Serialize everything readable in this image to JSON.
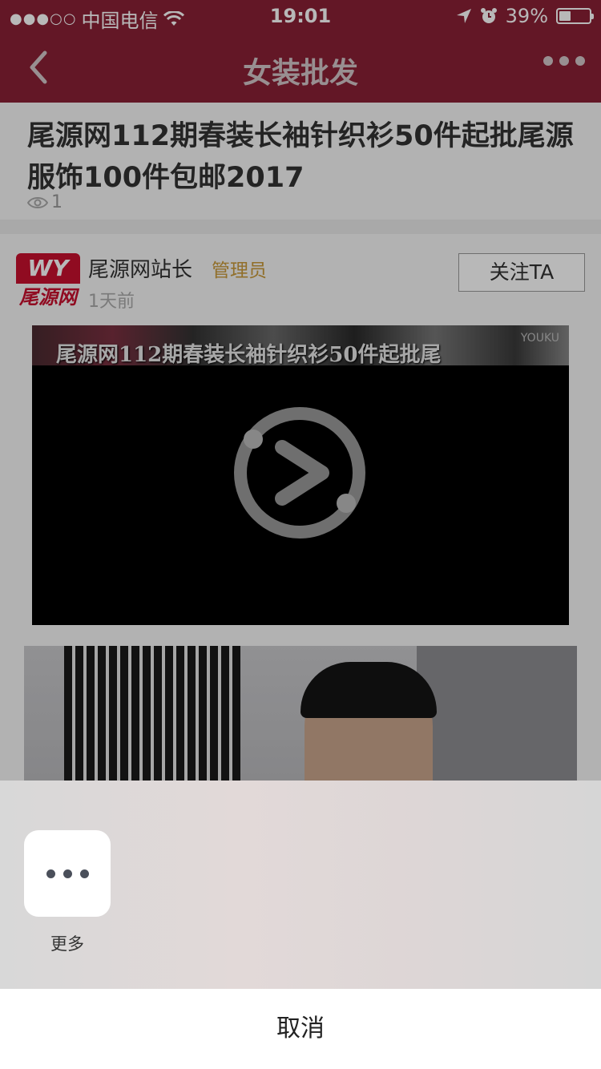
{
  "status_bar": {
    "signal": "●●●○○",
    "carrier": "中国电信",
    "time": "19:01",
    "battery": "39%",
    "battery_level": 0.39
  },
  "nav": {
    "title": "女装批发",
    "back_icon": "chevron-left-icon",
    "more_icon": "ellipsis-icon"
  },
  "article": {
    "title": "尾源网112期春装长袖针织衫50件起批尾源服饰100件包邮2017",
    "view_count": "1"
  },
  "author": {
    "logo_top": "WY",
    "logo_bottom": "尾源网",
    "name": "尾源网站长",
    "role": "管理员",
    "time_ago": "1天前",
    "follow_label": "关注TA"
  },
  "video": {
    "caption": "尾源网112期春装长袖针织衫50件起批尾",
    "brand": "YOUKU"
  },
  "share_sheet": {
    "items": [
      {
        "label": "更多",
        "icon": "more-dots-icon"
      }
    ],
    "cancel_label": "取消"
  },
  "colors": {
    "nav_bg": "#8a2035",
    "role_color": "#c99a3b",
    "logo_red": "#c8102e"
  }
}
